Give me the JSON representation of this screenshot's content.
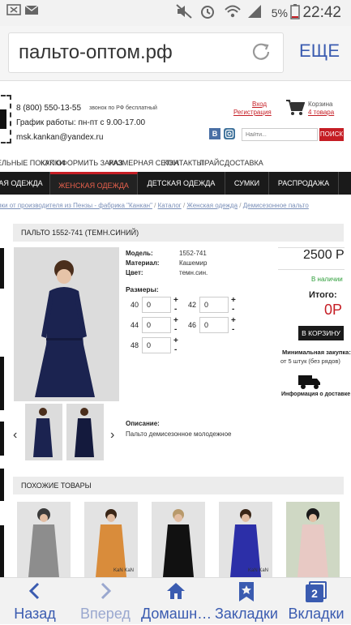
{
  "status": {
    "battery_percent": "5%",
    "time": "22:42"
  },
  "browser": {
    "url": "пальто-оптом.рф",
    "menu_label": "ЕЩЕ",
    "bottom": {
      "back": "Назад",
      "forward": "Вперед",
      "home": "Домашн…",
      "bookmarks": "Закладки",
      "tabs": "Вкладки",
      "tabs_count": "2"
    }
  },
  "header": {
    "phone": "8 (800) 550-13-55",
    "phone_note": "звонок по РФ бесплатный",
    "schedule": "График работы: пн-пт с 9.00-17.00",
    "email": "msk.kankan@yandex.ru",
    "login": "Вход",
    "register": "Регистрация",
    "cart_label": "Корзина",
    "cart_count": "4 товара",
    "search_placeholder": "Найти...",
    "search_button": "ПОИСК"
  },
  "topnav": [
    "ЕЛЬНЫЕ ПОКУПКИ",
    "КАК ОФОРМИТЬ ЗАКАЗ",
    "РАЗМЕРНАЯ СЕТКА",
    "КОНТАКТЫ",
    "ПРАЙС",
    "ДОСТАВКА"
  ],
  "mainnav": [
    "АЯ ОДЕЖДА",
    "ЖЕНСКАЯ ОДЕЖДА",
    "ДЕТСКАЯ ОДЕЖДА",
    "СУМКИ",
    "РАСПРОДАЖА"
  ],
  "breadcrumb": {
    "first": "мки от производителя из Пензы - фабрика \"Канкан\"",
    "sep": "/",
    "catalog": "Каталог",
    "women": "Женская одежда",
    "current": "Демисезонное пальто"
  },
  "product": {
    "title": "ПАЛЬТО 1552-741 (ТЕМН.СИНИЙ)",
    "model_label": "Модель:",
    "model": "1552-741",
    "material_label": "Материал:",
    "material": "Кашемир",
    "color_label": "Цвет:",
    "color": "темн.син.",
    "sizes_label": "Размеры:",
    "sizes": [
      {
        "size": "40",
        "qty": "0"
      },
      {
        "size": "42",
        "qty": "0"
      },
      {
        "size": "44",
        "qty": "0"
      },
      {
        "size": "46",
        "qty": "0"
      },
      {
        "size": "48",
        "qty": "0"
      }
    ],
    "plus": "+",
    "minus": "-",
    "price": "2500 Р",
    "availability": "В наличии",
    "total_label": "Итого:",
    "total": "0Р",
    "buy_button": "В КОРЗИНУ",
    "min_order_label": "Минимальная закупка:",
    "min_order": "от 5 штук (без рядов)",
    "delivery_info": "Информация о доставке",
    "description_label": "Описание:",
    "description": "Пальто демисезонное молодежное",
    "thumb_brand": "KaN KaN"
  },
  "similar": {
    "title": "ПОХОЖИЕ ТОВАРЫ",
    "brand": "KaN KaN"
  },
  "colors": {
    "accent": "#c51d24",
    "nav_bg": "#1a1a1a",
    "browser_blue": "#3a5bb0",
    "in_stock": "#2e9e3a",
    "coat_navy": "#1b2350",
    "vk": "#4a6fa5",
    "instagram": "#3f729b"
  }
}
